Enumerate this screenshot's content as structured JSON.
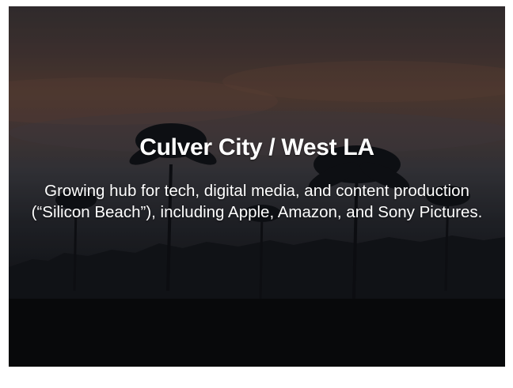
{
  "card": {
    "title": "Culver City / West LA",
    "description": "Growing hub for tech, digital media, and content production (“Silicon Beach”), including Apple, Amazon, and Sony Pictures."
  },
  "colors": {
    "text": "#ffffff",
    "sky_warm": "#5a4238",
    "ground_dark": "#0d0f13"
  }
}
